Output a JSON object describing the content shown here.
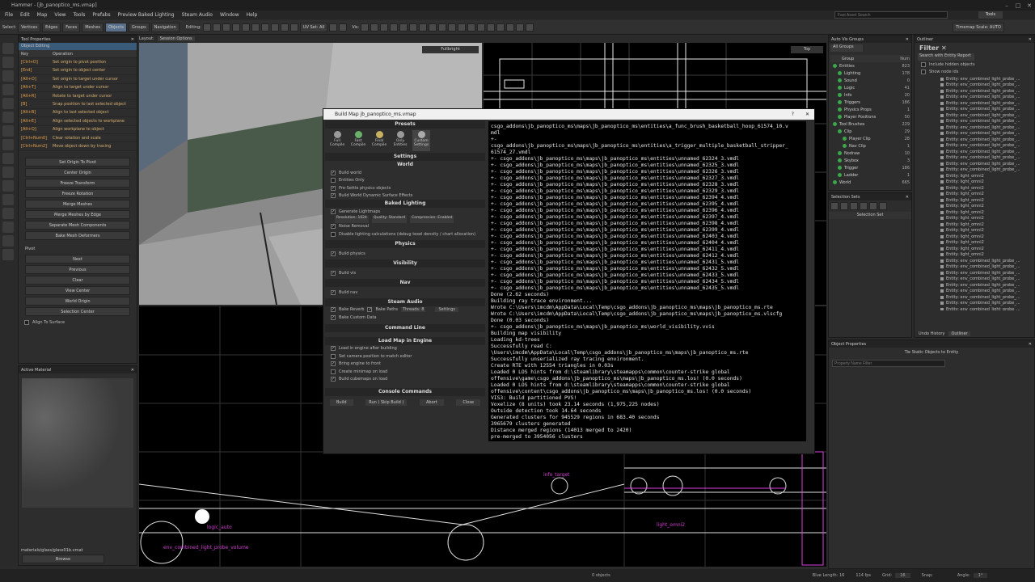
{
  "window": {
    "title": "Hammer - [jb_panoptico_ms.vmap]"
  },
  "menu": [
    "File",
    "Edit",
    "Map",
    "View",
    "Tools",
    "Prefabs",
    "Preview Baked Lighting",
    "Steam Audio",
    "Window",
    "Help"
  ],
  "search": {
    "placeholder": "Fast Asset Search"
  },
  "top_right": {
    "tools_label": "Tools"
  },
  "toolbar": {
    "select_label": "Select:",
    "modes": [
      "Vertices",
      "Edges",
      "Faces",
      "Meshes",
      "Objects",
      "Groups",
      "Navigation"
    ],
    "editing_label": "Editing:",
    "uv_set": "UV Set: All",
    "vis_label": "Vis:",
    "timemap": "Timemap Scale: AUTO"
  },
  "tool_properties": {
    "title": "Tool Properties",
    "subtitle": "Object Editing",
    "col_key": "Key",
    "col_op": "Operation",
    "shortcuts": [
      {
        "k": "[Ctrl+D]",
        "o": "Set origin to pivot position"
      },
      {
        "k": "[End]",
        "o": "Set origin to object center"
      },
      {
        "k": "[Alt+O]",
        "o": "Set origin to target under cursor"
      },
      {
        "k": "[Alt+T]",
        "o": "Align to target under cursor"
      },
      {
        "k": "[Alt+R]",
        "o": "Rotate to target under cursor"
      },
      {
        "k": "[B]",
        "o": "Snap position to last selected object"
      },
      {
        "k": "[Alt+B]",
        "o": "Align to last selected object"
      },
      {
        "k": "[Alt+E]",
        "o": "Align selected objects to workplane"
      },
      {
        "k": "[Alt+Q]",
        "o": "Align workplane to object"
      },
      {
        "k": "[Ctrl+Num0]",
        "o": "Clear rotation and scale"
      },
      {
        "k": "[Ctrl+Num2]",
        "o": "Move object down by tracing"
      }
    ],
    "buttons": [
      "Set Origin To Pivot",
      "Center Origin",
      "Freeze Transform",
      "Freeze Rotation",
      "Merge Meshes",
      "Merge Meshes by Edge",
      "Separate Mesh Components",
      "Bake Mesh Deformers"
    ],
    "pivot_label": "Pivot",
    "pivot_buttons": [
      "Next",
      "Previous",
      "Clear",
      "View Center",
      "World Origin",
      "Selection Center"
    ],
    "align_surface": "Align To Surface"
  },
  "active_material": {
    "title": "Active Material",
    "path": "materials/glass/glass01b.vmat",
    "browse": "Browse"
  },
  "layout": {
    "label": "Layout:",
    "session": "Session Options"
  },
  "viewports": {
    "persp_mode": "Fullbright",
    "top_label": "Top"
  },
  "build_dialog": {
    "title": "Build Map jb_panoptico_ms.vmap",
    "help": "?",
    "presets_title": "Presets",
    "presets": [
      "Full Compile",
      "Fast Compile",
      "Final Compile",
      "Only Entities",
      "Custom Settings"
    ],
    "settings_title": "Settings",
    "world_title": "World",
    "world": [
      {
        "label": "Build world",
        "checked": true
      },
      {
        "label": "Entities Only",
        "checked": false
      },
      {
        "label": "Pre-Settle physics objects",
        "checked": true
      },
      {
        "label": "Build World Dynamic Surface Effects",
        "checked": true
      }
    ],
    "baked_title": "Baked Lighting",
    "baked_gen": "Generate Lightmaps",
    "resolution": "Resolution: 1024",
    "quality": "Quality: Standard",
    "compression": "Compression: Enabled",
    "noise": "Noise Removal",
    "disable_calc": "Disable lighting calculations (debug texel density / chart allocation)",
    "physics_title": "Physics",
    "physics": "Build physics",
    "vis_title": "Visibility",
    "vis": "Build vis",
    "nav_title": "Nav",
    "nav": "Build nav",
    "audio_title": "Steam Audio",
    "reverb": "Bake Reverb",
    "paths": "Bake Paths",
    "threads": "Threads: 8",
    "audio_settings": "Settings",
    "custom_data": "Bake Custom Data",
    "cmd_title": "Command Line",
    "load_title": "Load Map in Engine",
    "load_opts": [
      {
        "label": "Load in engine after building",
        "checked": true
      },
      {
        "label": "Set camera position to match editor",
        "checked": false
      },
      {
        "label": "Bring engine to front",
        "checked": true
      },
      {
        "label": "Create minimap on load",
        "checked": false
      },
      {
        "label": "Build cubemaps on load",
        "checked": true
      }
    ],
    "console_title": "Console Commands",
    "buttons": [
      "Build",
      "Run ( Skip Build )",
      "Abort",
      "Close"
    ]
  },
  "console_lines": [
    "csgo_addons\\jb_panoptico_ms\\maps\\jb_panoptico_ms\\entities\\a_func_brush_basketball_hoop_61574_10.v",
    "mdl",
    "+-",
    "csgo_addons\\jb_panoptico_ms\\maps\\jb_panoptico_ms\\entities\\a_trigger_multiple_basketball_stripper_",
    "61574_27.vmdl",
    "+- csgo_addons\\jb_panoptico_ms\\maps\\jb_panoptico_ms\\entities\\unnamed_62324_3.vmdl",
    "+- csgo_addons\\jb_panoptico_ms\\maps\\jb_panoptico_ms\\entities\\unnamed_62325_3.vmdl",
    "+- csgo_addons\\jb_panoptico_ms\\maps\\jb_panoptico_ms\\entities\\unnamed_62326_3.vmdl",
    "+- csgo_addons\\jb_panoptico_ms\\maps\\jb_panoptico_ms\\entities\\unnamed_62327_3.vmdl",
    "+- csgo_addons\\jb_panoptico_ms\\maps\\jb_panoptico_ms\\entities\\unnamed_62328_3.vmdl",
    "+- csgo_addons\\jb_panoptico_ms\\maps\\jb_panoptico_ms\\entities\\unnamed_62329_3.vmdl",
    "+- csgo_addons\\jb_panoptico_ms\\maps\\jb_panoptico_ms\\entities\\unnamed_62394_4.vmdl",
    "+- csgo_addons\\jb_panoptico_ms\\maps\\jb_panoptico_ms\\entities\\unnamed_62395_4.vmdl",
    "+- csgo_addons\\jb_panoptico_ms\\maps\\jb_panoptico_ms\\entities\\unnamed_62396_4.vmdl",
    "+- csgo_addons\\jb_panoptico_ms\\maps\\jb_panoptico_ms\\entities\\unnamed_62397_4.vmdl",
    "+- csgo_addons\\jb_panoptico_ms\\maps\\jb_panoptico_ms\\entities\\unnamed_62398_4.vmdl",
    "+- csgo_addons\\jb_panoptico_ms\\maps\\jb_panoptico_ms\\entities\\unnamed_62399_4.vmdl",
    "+- csgo_addons\\jb_panoptico_ms\\maps\\jb_panoptico_ms\\entities\\unnamed_62403_4.vmdl",
    "+- csgo_addons\\jb_panoptico_ms\\maps\\jb_panoptico_ms\\entities\\unnamed_62404_4.vmdl",
    "+- csgo_addons\\jb_panoptico_ms\\maps\\jb_panoptico_ms\\entities\\unnamed_62411_4.vmdl",
    "+- csgo_addons\\jb_panoptico_ms\\maps\\jb_panoptico_ms\\entities\\unnamed_62412_4.vmdl",
    "+- csgo_addons\\jb_panoptico_ms\\maps\\jb_panoptico_ms\\entities\\unnamed_62431_5.vmdl",
    "+- csgo_addons\\jb_panoptico_ms\\maps\\jb_panoptico_ms\\entities\\unnamed_62432_5.vmdl",
    "+- csgo_addons\\jb_panoptico_ms\\maps\\jb_panoptico_ms\\entities\\unnamed_62433_5.vmdl",
    "+- csgo_addons\\jb_panoptico_ms\\maps\\jb_panoptico_ms\\entities\\unnamed_62434_5.vmdl",
    "+- csgo_addons\\jb_panoptico_ms\\maps\\jb_panoptico_ms\\entities\\unnamed_62435_5.vmdl",
    "Done (2.62 seconds)",
    "Building ray trace environment...",
    "Wrote C:\\Users\\imcdm\\AppData\\Local\\Temp\\csgo_addons\\jb_panoptico_ms\\maps\\jb_panoptico_ms.rte",
    "Wrote C:\\Users\\imcdm\\AppData\\Local\\Temp\\csgo_addons\\jb_panoptico_ms\\maps\\jb_panoptico_ms.vlscfg",
    "Done (0.03 seconds)",
    "+- csgo_addons\\jb_panoptico_ms\\maps\\jb_panoptico_ms\\world_visibility.vvis",
    "Building map visibility",
    "",
    "Loading kd-trees",
    "Successfully read C:",
    "\\Users\\imcdm\\AppData\\Local\\Temp\\csgo_addons\\jb_panoptico_ms\\maps\\jb_panoptico_ms.rte",
    "Successfully unserialized ray tracing environment.",
    "Create RTE with 12554 triangles in 0.03s",
    "Loaded 0 LOS hints from d:\\steamlibrary\\steamapps\\common\\counter-strike global",
    "offensive\\game\\csgo_addons\\jb_panoptico_ms\\maps\\jb_panoptico_ms.los! (0.0 seconds)",
    "Loaded 0 LOS hints from d:\\steamlibrary\\steamapps\\common\\counter-strike global",
    "offensive\\content\\csgo_addons\\jb_panoptico_ms\\maps\\jb_panoptico_ms.los! (0.0 seconds)",
    "VIS3: Build partitioned PVS!",
    "Voxelize (8 units) took 23.14 seconds (1,975,225 nodes)",
    "Outside detection took 14.64 seconds",
    "Generated clusters for 945529 regions in 683.40 seconds",
    "3965679 clusters generated",
    "Distance merged regions (14013 merged to 2420)",
    "pre-merged to 3954056 clusters"
  ],
  "auto_vis": {
    "title": "Auto Vis Groups",
    "dropdown": "All Groups",
    "col_group": "Group",
    "col_num": "Num",
    "items": [
      {
        "n": "Entities",
        "c": "823",
        "i": 0
      },
      {
        "n": "Lighting",
        "c": "178",
        "i": 1
      },
      {
        "n": "Sound",
        "c": "0",
        "i": 1
      },
      {
        "n": "Logic",
        "c": "41",
        "i": 1
      },
      {
        "n": "Info",
        "c": "20",
        "i": 1
      },
      {
        "n": "Triggers",
        "c": "186",
        "i": 1
      },
      {
        "n": "Physics Props",
        "c": "1",
        "i": 1
      },
      {
        "n": "Player Positions",
        "c": "50",
        "i": 1
      },
      {
        "n": "Tool Brushes",
        "c": "229",
        "i": 0
      },
      {
        "n": "Clip",
        "c": "29",
        "i": 1
      },
      {
        "n": "Player Clip",
        "c": "28",
        "i": 2
      },
      {
        "n": "Nav Clip",
        "c": "1",
        "i": 2
      },
      {
        "n": "Nodraw",
        "c": "10",
        "i": 1
      },
      {
        "n": "Skybox",
        "c": "3",
        "i": 1
      },
      {
        "n": "Trigger",
        "c": "186",
        "i": 1
      },
      {
        "n": "Ladder",
        "c": "1",
        "i": 1
      },
      {
        "n": "World",
        "c": "665",
        "i": 0
      }
    ]
  },
  "selection_sets": {
    "title": "Selection Sets",
    "header": "Selection Set"
  },
  "outliner": {
    "title": "Outliner",
    "filter": "Filter",
    "search_btn": "Search with Entity Report",
    "include_hidden": "Include hidden objects",
    "show_node_ids": "Show node ids",
    "items": [
      "Entity: env_combined_light_probe_...",
      "Entity: env_combined_light_probe_...",
      "Entity: env_combined_light_probe_...",
      "Entity: env_combined_light_probe_...",
      "Entity: env_combined_light_probe_...",
      "Entity: env_combined_light_probe_...",
      "Entity: env_combined_light_probe_...",
      "Entity: env_combined_light_probe_...",
      "Entity: env_combined_light_probe_...",
      "Entity: env_combined_light_probe_...",
      "Entity: env_combined_light_probe_...",
      "Entity: env_combined_light_probe_...",
      "Entity: env_combined_light_probe_...",
      "Entity: env_combined_light_probe_...",
      "Entity: env_combined_light_probe_...",
      "Entity: env_combined_light_probe_...",
      "Entity: light_omni2",
      "Entity: light_omni2",
      "Entity: light_omni2",
      "Entity: light_omni2",
      "Entity: light_omni2",
      "Entity: light_omni2",
      "Entity: light_omni2",
      "Entity: light_omni2",
      "Entity: light_omni2",
      "Entity: light_omni2",
      "Entity: light_omni2",
      "Entity: light_omni2",
      "Entity: light_omni2",
      "Entity: light_omni2",
      "Entity: env_combined_light_probe_...",
      "Entity: env_combined_light_probe_...",
      "Entity: env_combined_light_probe_...",
      "Entity: env_combined_light_probe_...",
      "Entity: env_combined_light_probe_...",
      "Entity: env_combined_light_probe_...",
      "Entity: env_combined_light_probe_...",
      "Entity: env_combined_light_probe_...",
      "Entity: env_combined_light_probe_...",
      "Entity: env_combined_light_probe_..."
    ],
    "tabs": [
      "Undo History",
      "Outliner"
    ]
  },
  "object_properties": {
    "title": "Object Properties",
    "tie_btn": "Tie Static Objects to Entity",
    "filter_placeholder": "Property Name Filter"
  },
  "status": {
    "objects": "0 objects",
    "blue": "Blue Length: 16",
    "fps": "114 fps",
    "grid": "Grid:",
    "grid_val": "16",
    "snap": "Snap:",
    "angle": "Angle:",
    "angle_val": "1°"
  },
  "viewport_labels": [
    "logic_auto",
    "env_combined_light_probe_volume",
    "light_omni2",
    "info_target"
  ]
}
